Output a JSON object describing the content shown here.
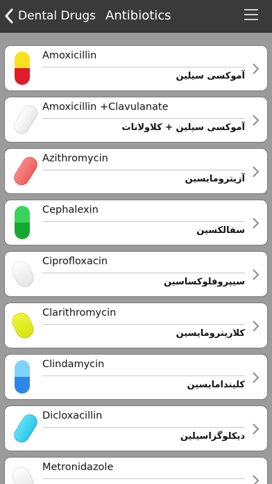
{
  "nav": {
    "back_label": "Dental Drugs",
    "title": "Antibiotics"
  },
  "drugs": [
    {
      "name_en": "Amoxicillin",
      "name_fa": "آموکسی سیلین",
      "pill": "capsule",
      "color_top": "#f7e21c",
      "color_bottom": "#e01b2a"
    },
    {
      "name_en": "Amoxicillin +Clavulanate",
      "name_fa": "آموکسی سیلین + کلاولانات",
      "pill": "tablet-diagonal",
      "color_top": "#f2f2f2",
      "color_bottom": "#f2f2f2"
    },
    {
      "name_en": "Azithromycin",
      "name_fa": "آزیترومایسین",
      "pill": "tablet-diagonal",
      "color_top": "#f46f6f",
      "color_bottom": "#f46f6f"
    },
    {
      "name_en": "Cephalexin",
      "name_fa": "سفالکسین",
      "pill": "capsule",
      "color_top": "#3ad45a",
      "color_bottom": "#15a832"
    },
    {
      "name_en": "Ciprofloxacin",
      "name_fa": "سیپروفلوکساسین",
      "pill": "tablet-oval",
      "color_top": "#f2f2f2",
      "color_bottom": "#f2f2f2"
    },
    {
      "name_en": "Clarithromycin",
      "name_fa": "کلاریترومایسین",
      "pill": "tablet-oval",
      "color_top": "#e3ee1a",
      "color_bottom": "#e3ee1a"
    },
    {
      "name_en": "Clindamycin",
      "name_fa": "کلیندامایسین",
      "pill": "capsule",
      "color_top": "#7fd3ff",
      "color_bottom": "#2e86e8"
    },
    {
      "name_en": "Dicloxacillin",
      "name_fa": "دیکلوگزاسیلین",
      "pill": "tablet-diagonal",
      "color_top": "#3fd4f3",
      "color_bottom": "#3fd4f3"
    },
    {
      "name_en": "Metronidazole",
      "name_fa": "",
      "pill": "tablet-oval",
      "color_top": "#f2f2f2",
      "color_bottom": "#f2f2f2"
    }
  ]
}
